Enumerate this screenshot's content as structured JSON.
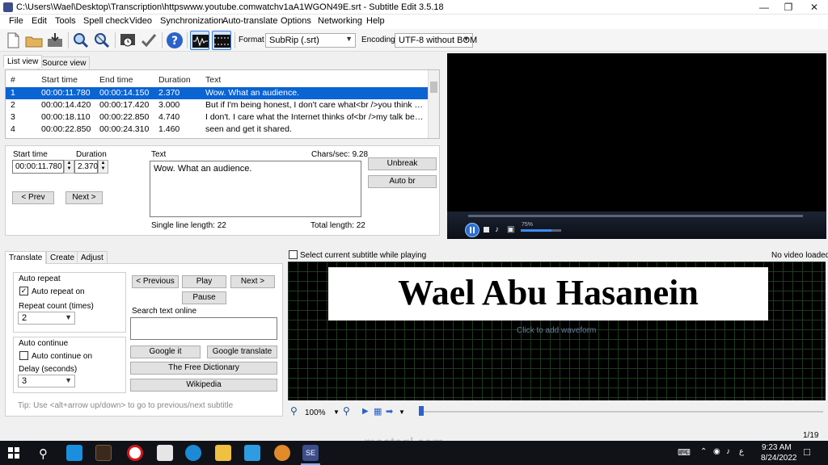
{
  "window": {
    "title": "C:\\Users\\Wael\\Desktop\\Transcription\\httpswww.youtube.comwatchv1aA1WGON49E.srt - Subtitle Edit 3.5.18"
  },
  "menu": [
    "File",
    "Edit",
    "Tools",
    "Spell check",
    "Video",
    "Synchronization",
    "Auto-translate",
    "Options",
    "Networking",
    "Help"
  ],
  "toolbar": {
    "format_label": "Format",
    "format_value": "SubRip (.srt)",
    "encoding_label": "Encoding",
    "encoding_value": "UTF-8 without BOM"
  },
  "view_tabs": [
    "List view",
    "Source view"
  ],
  "list": {
    "headers": [
      "#",
      "Start time",
      "End time",
      "Duration",
      "Text"
    ],
    "rows": [
      [
        "1",
        "00:00:11.780",
        "00:00:14.150",
        "2.370",
        "Wow. What an audience."
      ],
      [
        "2",
        "00:00:14.420",
        "00:00:17.420",
        "3.000",
        "But if I'm being honest, I don't care what<br />you think of ..."
      ],
      [
        "3",
        "00:00:18.110",
        "00:00:22.850",
        "4.740",
        "I don't. I care what the Internet thinks of<br />my talk beca..."
      ],
      [
        "4",
        "00:00:22.850",
        "00:00:24.310",
        "1.460",
        "seen and get it shared."
      ]
    ]
  },
  "editor": {
    "start_time_label": "Start time",
    "start_time_value": "00:00:11.780",
    "duration_label": "Duration",
    "duration_value": "2.370",
    "text_label": "Text",
    "chars_sec": "Chars/sec: 9.28",
    "text_value": "Wow. What an audience.",
    "prev_label": "< Prev",
    "next_label": "Next >",
    "unbreak_label": "Unbreak",
    "auto_br_label": "Auto br",
    "single_line_length": "Single line length: 22",
    "total_length": "Total length: 22"
  },
  "video": {
    "volume": "75%",
    "select_current_label": "Select current subtitle while playing",
    "no_video_loaded": "No video loaded"
  },
  "bottom_tabs": [
    "Translate",
    "Create",
    "Adjust"
  ],
  "translate": {
    "auto_repeat_group": "Auto repeat",
    "auto_repeat_on": "Auto repeat on",
    "repeat_count_label": "Repeat count (times)",
    "repeat_count_value": "2",
    "auto_continue_group": "Auto continue",
    "auto_continue_on": "Auto continue on",
    "delay_label": "Delay (seconds)",
    "delay_value": "3",
    "previous_label": "< Previous",
    "play_label": "Play",
    "next_label": "Next >",
    "pause_label": "Pause",
    "search_online_label": "Search text online",
    "google_it": "Google it",
    "google_translate": "Google translate",
    "free_dictionary": "The Free Dictionary",
    "wikipedia": "Wikipedia",
    "tip": "Tip: Use <alt+arrow up/down> to go to previous/next subtitle"
  },
  "waveform": {
    "banner_text": "Wael Abu Hasanein",
    "click_to_add": "Click to add waveform",
    "zoom": "100%",
    "position": "1/19"
  },
  "watermark": "mostaql.com",
  "taskbar": {
    "time": "9:23 AM",
    "date": "8/24/2022"
  }
}
